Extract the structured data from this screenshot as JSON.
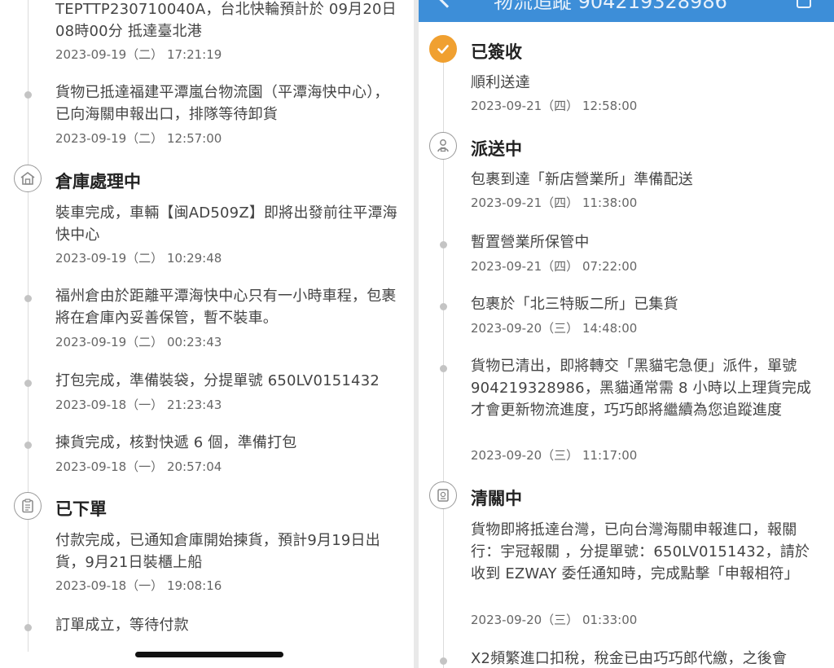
{
  "header": {
    "title": "物流追蹤 904219328986"
  },
  "left_timeline": {
    "entries": [
      {
        "type": "dot",
        "message": "TEPTTP230710040A，台北快輪預計於 09月20日 08時00分 抵達臺北港",
        "time": "2023-09-19（二） 17:21:19"
      },
      {
        "type": "dot",
        "message": "貨物已抵達福建平潭嵐台物流園（平潭海快中心），已向海關申報出口，排隊等待卸貨",
        "time": "2023-09-19（二） 12:57:00"
      },
      {
        "type": "status",
        "icon": "warehouse-icon",
        "status": "倉庫處理中",
        "message": "裝車完成，車輛【闽AD509Z】即將出發前往平潭海快中心",
        "time": "2023-09-19（二） 10:29:48"
      },
      {
        "type": "dot",
        "message": "福州倉由於距離平潭海快中心只有一小時車程，包裹將在倉庫內妥善保管，暫不裝車。",
        "time": "2023-09-19（二） 00:23:43"
      },
      {
        "type": "dot",
        "message": "打包完成，準備裝袋，分提單號 650LV0151432",
        "time": "2023-09-18（一） 21:23:43"
      },
      {
        "type": "dot",
        "message": "揀貨完成，核對快遞 6 個，準備打包",
        "time": "2023-09-18（一） 20:57:04"
      },
      {
        "type": "status",
        "icon": "clipboard-icon",
        "status": "已下單",
        "message": "付款完成，已通知倉庫開始揀貨，預計9月19日出貨，9月21日裝櫃上船",
        "time": "2023-09-18（一） 19:08:16"
      },
      {
        "type": "dot",
        "message": "訂單成立，等待付款",
        "time": ""
      }
    ]
  },
  "right_timeline": {
    "entries": [
      {
        "type": "status",
        "icon": "check-icon",
        "status": "已簽收",
        "message": "順利送達",
        "time": "2023-09-21（四） 12:58:00"
      },
      {
        "type": "status",
        "icon": "courier-icon",
        "status": "派送中",
        "message": "包裹到達「新店營業所」準備配送",
        "time": "2023-09-21（四） 11:38:00"
      },
      {
        "type": "dot",
        "message": "暫置營業所保管中",
        "time": "2023-09-21（四） 07:22:00"
      },
      {
        "type": "dot",
        "message": "包裹於「北三特販二所」已集貨",
        "time": "2023-09-20（三） 14:48:00"
      },
      {
        "type": "dot",
        "message": "貨物已清出，即將轉交「黑貓宅急便」派件，單號 904219328986，黑貓通常需 8 小時以上理貨完成才會更新物流進度，巧巧郎將繼續為您追蹤進度",
        "time": "2023-09-20（三） 11:17:00"
      },
      {
        "type": "status",
        "icon": "customs-icon",
        "status": "清關中",
        "message": "貨物即將抵達台灣，已向台灣海關申報進口，報關行：宇冠報關 ，分提單號：650LV0151432，請於收到 EZWAY 委任通知時，完成點擊「申報相符」",
        "time": "2023-09-20（三） 01:33:00"
      },
      {
        "type": "dot",
        "message": "X2頻繁進口扣稅，稅金已由巧巧郎代繳，之後會",
        "time": ""
      }
    ]
  },
  "colors": {
    "accent": "#3d8ed8",
    "done": "#f0a030",
    "text": "#444444",
    "muted": "#666666"
  }
}
